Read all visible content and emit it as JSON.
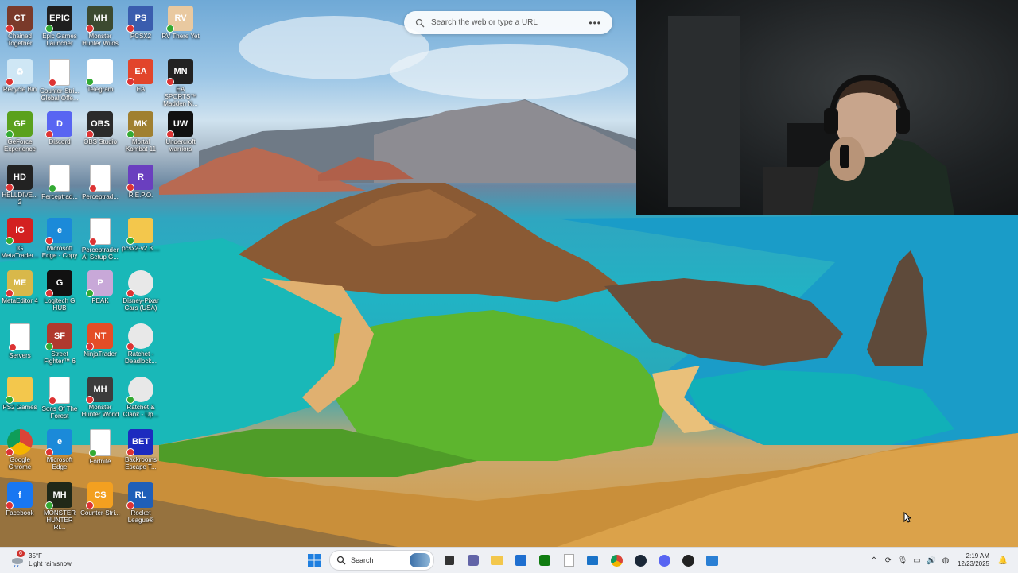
{
  "search_widget": {
    "placeholder": "Search the web or type a URL",
    "more_label": "•••"
  },
  "desktop_icons": [
    {
      "label": "Chained Together",
      "icon": "chained-together-icon",
      "color": "#7a3a2a",
      "text": "CT"
    },
    {
      "label": "Epic Games Launcher",
      "icon": "epic-games-icon",
      "color": "#1f1f1f",
      "text": "EPIC"
    },
    {
      "label": "Monster Hunter Wilds",
      "icon": "monster-hunter-wilds-icon",
      "color": "#3c4a30",
      "text": "MH"
    },
    {
      "label": "PCSX2",
      "icon": "pcsx2-icon",
      "color": "#3a5dae",
      "text": "PS"
    },
    {
      "label": "RV There Yet",
      "icon": "rv-there-yet-icon",
      "color": "#e9c9a0",
      "text": "RV"
    },
    {
      "label": "Recycle Bin",
      "icon": "recycle-bin-icon",
      "color": "#cfe7f5",
      "text": "♻"
    },
    {
      "label": "Counter-Stri... Global Offe...",
      "icon": "file-icon",
      "color": "#ffffff",
      "text": ""
    },
    {
      "label": "Telegram",
      "icon": "telegram-icon",
      "color": "#ffffff",
      "text": ""
    },
    {
      "label": "EA",
      "icon": "ea-icon",
      "color": "#e2452b",
      "text": "EA"
    },
    {
      "label": "EA SPORTS™ Madden N...",
      "icon": "madden-icon",
      "color": "#222222",
      "text": "MN"
    },
    {
      "label": "GeForce Experience",
      "icon": "geforce-icon",
      "color": "#5aa11d",
      "text": "GF"
    },
    {
      "label": "Discord",
      "icon": "discord-icon",
      "color": "#5865f2",
      "text": "D"
    },
    {
      "label": "OBS Studio",
      "icon": "obs-icon",
      "color": "#2b2b2b",
      "text": "OBS"
    },
    {
      "label": "Mortal Kombat 11",
      "icon": "mortal-kombat-icon",
      "color": "#a08030",
      "text": "MK"
    },
    {
      "label": "Undercroft warriors",
      "icon": "undercroft-icon",
      "color": "#111111",
      "text": "UW"
    },
    {
      "label": "HELLDIVE... 2",
      "icon": "helldivers-icon",
      "color": "#222222",
      "text": "HD"
    },
    {
      "label": "Perceptrad...",
      "icon": "file-icon",
      "color": "#ffffff",
      "text": ""
    },
    {
      "label": "Perceptrad...",
      "icon": "file-icon",
      "color": "#ffffff",
      "text": ""
    },
    {
      "label": "R.E.P.O.",
      "icon": "repo-icon",
      "color": "#6a3fbf",
      "text": "R"
    },
    {
      "label": "IG MetaTrader...",
      "icon": "ig-metatrader-icon",
      "color": "#d32020",
      "text": "IG"
    },
    {
      "label": "Microsoft Edge - Copy",
      "icon": "edge-icon",
      "color": "#1b8ad9",
      "text": "e"
    },
    {
      "label": "Perceptrader AI Setup G...",
      "icon": "chrome-file-icon",
      "color": "#ffffff",
      "text": ""
    },
    {
      "label": "pcsx2-v2.3....",
      "icon": "folder-icon",
      "color": "#f3c74c",
      "text": ""
    },
    {
      "label": "MetaEditor 4",
      "icon": "metaeditor-icon",
      "color": "#d8b84a",
      "text": "ME"
    },
    {
      "label": "Logitech G HUB",
      "icon": "logitech-icon",
      "color": "#111111",
      "text": "G"
    },
    {
      "label": "PEAK",
      "icon": "peak-icon",
      "color": "#c8a8d8",
      "text": "P"
    },
    {
      "label": "Disney-Pixar Cars (USA)",
      "icon": "disc-icon",
      "color": "#e8e8e8",
      "text": ""
    },
    {
      "label": "Servers",
      "icon": "file-icon",
      "color": "#ffffff",
      "text": ""
    },
    {
      "label": "Street Fighter™ 6",
      "icon": "street-fighter-icon",
      "color": "#b03a2e",
      "text": "SF"
    },
    {
      "label": "NinjaTrader",
      "icon": "ninjatrader-icon",
      "color": "#e44d26",
      "text": "NT"
    },
    {
      "label": "Ratchet - Deadlock...",
      "icon": "disc-icon",
      "color": "#e8e8e8",
      "text": ""
    },
    {
      "label": "PS2 Games",
      "icon": "folder-icon",
      "color": "#f3c74c",
      "text": ""
    },
    {
      "label": "Sons Of The Forest",
      "icon": "file-icon",
      "color": "#ffffff",
      "text": ""
    },
    {
      "label": "Monster Hunter World",
      "icon": "monster-hunter-world-icon",
      "color": "#3c3c3c",
      "text": "MH"
    },
    {
      "label": "Ratchet & Clank - Up...",
      "icon": "disc-icon",
      "color": "#e8e8e8",
      "text": ""
    },
    {
      "label": "Google Chrome",
      "icon": "chrome-icon",
      "color": "#ffffff",
      "text": ""
    },
    {
      "label": "Microsoft Edge",
      "icon": "edge-icon",
      "color": "#1b8ad9",
      "text": "e"
    },
    {
      "label": "Fortnite",
      "icon": "file-icon",
      "color": "#ffffff",
      "text": ""
    },
    {
      "label": "Backrooms Escape T...",
      "icon": "backrooms-icon",
      "color": "#1c2bbf",
      "text": "BET"
    },
    {
      "label": "Facebook",
      "icon": "facebook-icon",
      "color": "#1877f2",
      "text": "f"
    },
    {
      "label": "MONSTER HUNTER RI...",
      "icon": "monster-hunter-rise-icon",
      "color": "#202818",
      "text": "MH"
    },
    {
      "label": "Counter-Stri...",
      "icon": "counter-strike-icon",
      "color": "#f3a020",
      "text": "CS"
    },
    {
      "label": "Rocket League®",
      "icon": "rocket-league-icon",
      "color": "#1f5fb8",
      "text": "RL"
    }
  ],
  "taskbar": {
    "weather": {
      "temp": "35°F",
      "condition": "Light rain/snow",
      "alert_count": "6"
    },
    "search_label": "Search",
    "time": "2:19 AM",
    "date": "12/23/2025"
  }
}
